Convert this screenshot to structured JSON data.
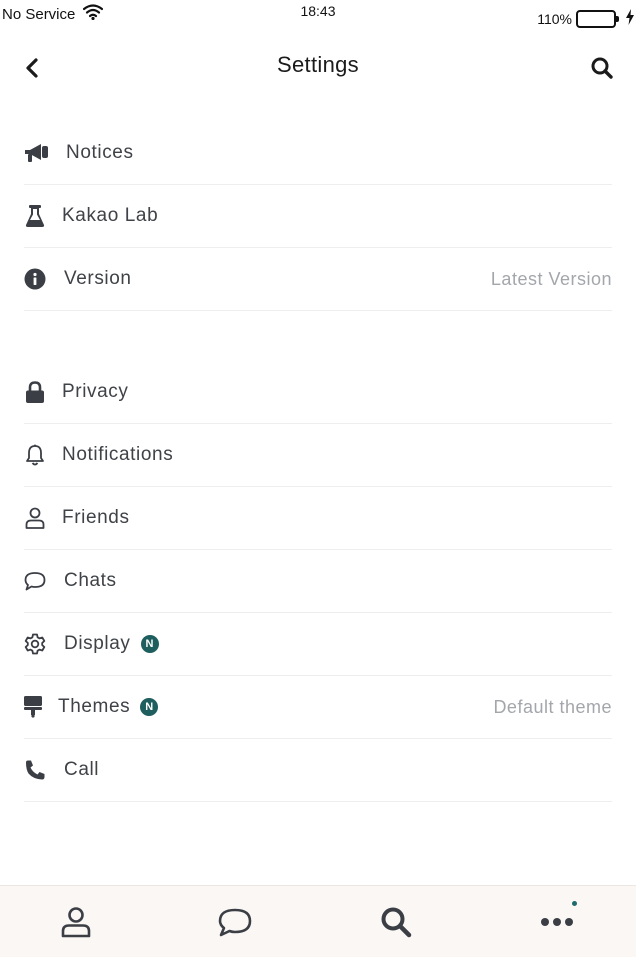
{
  "status_bar": {
    "carrier": "No Service",
    "time": "18:43",
    "battery": "110%"
  },
  "header": {
    "title": "Settings"
  },
  "groups": [
    {
      "items": [
        {
          "label": "Notices",
          "icon": "megaphone-icon"
        },
        {
          "label": "Kakao Lab",
          "icon": "flask-icon"
        },
        {
          "label": "Version",
          "icon": "info-icon",
          "value": "Latest Version"
        }
      ]
    },
    {
      "items": [
        {
          "label": "Privacy",
          "icon": "lock-icon"
        },
        {
          "label": "Notifications",
          "icon": "bell-icon"
        },
        {
          "label": "Friends",
          "icon": "person-icon"
        },
        {
          "label": "Chats",
          "icon": "chat-bubble-icon"
        },
        {
          "label": "Display",
          "icon": "gear-icon",
          "badge": "N"
        },
        {
          "label": "Themes",
          "icon": "paint-roller-icon",
          "badge": "N",
          "value": "Default theme"
        },
        {
          "label": "Call",
          "icon": "phone-icon"
        }
      ]
    }
  ],
  "tabbar": {
    "tabs": [
      {
        "name": "friends",
        "icon": "person-icon"
      },
      {
        "name": "chats",
        "icon": "chat-bubble-icon"
      },
      {
        "name": "search",
        "icon": "search-icon"
      },
      {
        "name": "more",
        "icon": "more-icon",
        "has_dot": true
      }
    ]
  },
  "colors": {
    "badge": "#1e5e5e",
    "text": "#3f4247",
    "secondary_text": "#a3a6ab",
    "tabbar_bg": "#fbf7f5"
  }
}
